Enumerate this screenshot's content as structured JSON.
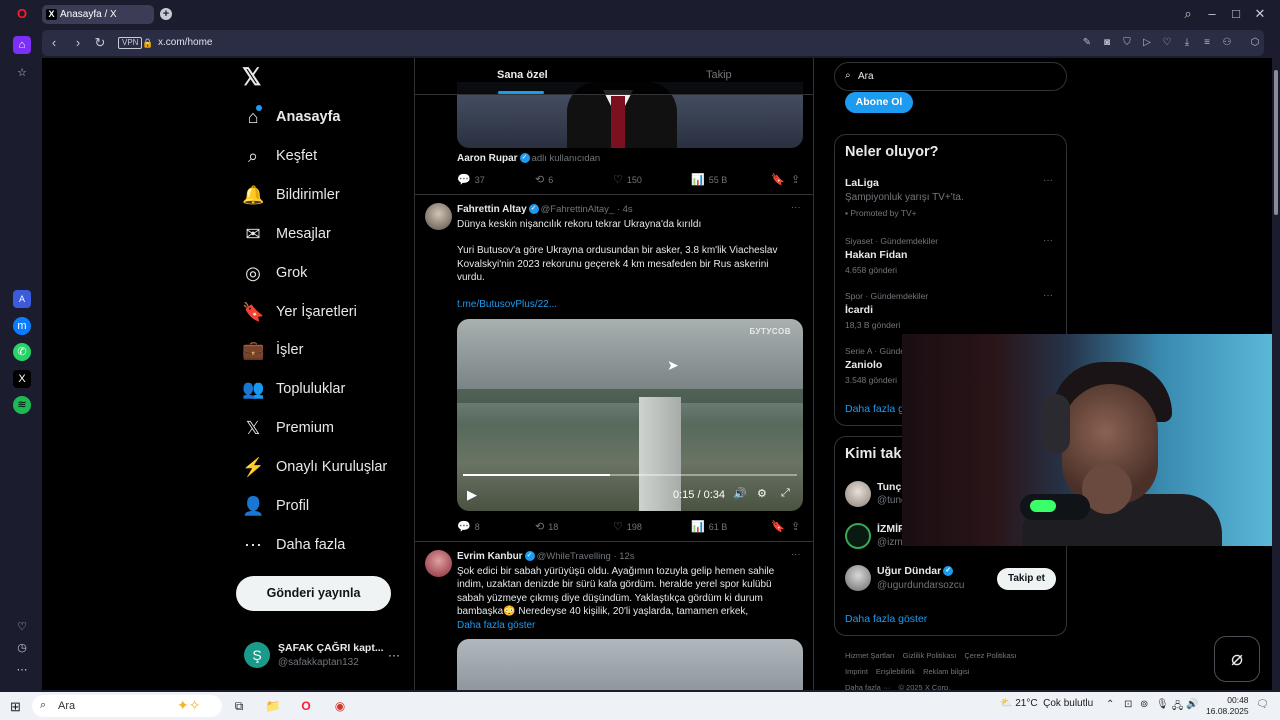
{
  "browser": {
    "tab_title": "Anasayfa / X",
    "url": "x.com/home",
    "vpn_label": "VPN"
  },
  "nav": {
    "logo": "𝕏",
    "items": [
      {
        "label": "Anasayfa",
        "icon": "home-icon",
        "glyph": "⌂"
      },
      {
        "label": "Keşfet",
        "icon": "search-icon",
        "glyph": "⌕"
      },
      {
        "label": "Bildirimler",
        "icon": "bell-icon",
        "glyph": "🔔"
      },
      {
        "label": "Mesajlar",
        "icon": "mail-icon",
        "glyph": "✉"
      },
      {
        "label": "Grok",
        "icon": "grok-icon",
        "glyph": "◎"
      },
      {
        "label": "Yer İşaretleri",
        "icon": "bookmark-icon",
        "glyph": "🔖"
      },
      {
        "label": "İşler",
        "icon": "briefcase-icon",
        "glyph": "💼"
      },
      {
        "label": "Topluluklar",
        "icon": "people-icon",
        "glyph": "👥"
      },
      {
        "label": "Premium",
        "icon": "x-premium-icon",
        "glyph": "𝕏"
      },
      {
        "label": "Onaylı Kuruluşlar",
        "icon": "lightning-icon",
        "glyph": "⚡"
      },
      {
        "label": "Profil",
        "icon": "person-icon",
        "glyph": "👤"
      },
      {
        "label": "Daha fazla",
        "icon": "more-circle-icon",
        "glyph": "⋯"
      }
    ],
    "post_button": "Gönderi yayınla",
    "account": {
      "avatar_letter": "Ş",
      "name": "ŞAFAK ÇAĞRI kapt...",
      "handle": "@safakkaptan132",
      "more": "···"
    }
  },
  "timeline": {
    "tabs": [
      "Sana özel",
      "Takip"
    ],
    "tweet0": {
      "name": "Aaron Rupar",
      "label": "adlı kullanıcıdan",
      "replies": "37",
      "retweets": "6",
      "likes": "150",
      "views": "55 B"
    },
    "tweet1": {
      "name": "Fahrettin Altay",
      "handle": "@FahrettinAltay_",
      "time": "· 4s",
      "line1": "Dünya keskin nişancılık rekoru tekrar Ukrayna'da kırıldı",
      "line2": "Yuri Butusov'a göre Ukrayna ordusundan bir asker, 3.8 km'lik Viacheslav",
      "line3": "Kovalskyi'nin 2023 rekorunu geçerek 4 km mesafeden bir Rus askerini",
      "line4": "vurdu.",
      "link": "t.me/ButusovPlus/22...",
      "video_logo": "БУТУСОВ",
      "video_time": "0:15 / 0:34",
      "video_progress": 0.44,
      "replies": "8",
      "retweets": "18",
      "likes": "198",
      "views": "61 B"
    },
    "tweet2": {
      "name": "Evrim Kanbur",
      "handle": "@WhileTravelling",
      "time": "· 12s",
      "line1": "Şok edici bir sabah yürüyüşü oldu. Ayağımın tozuyla gelip hemen sahile",
      "line2": "indim, uzaktan denizde bir sürü kafa gördüm. heralde yerel spor kulübü",
      "line3": "sabah yüzmeye çıkmış diye düşündüm. Yaklaştıkça gördüm ki durum",
      "line4": "bambaşka😳 Neredeyse 40 kişilik, 20'li yaşlarda, tamamen erkek,",
      "show_more": "Daha fazla göster"
    }
  },
  "right": {
    "search_placeholder": "Ara",
    "subscribe": "Abone Ol",
    "trends_title": "Neler oluyor?",
    "trends": [
      {
        "meta": "",
        "name": "LaLiga",
        "desc": "Şampiyonluk yarışı TV+'ta.",
        "promo": "Promoted by TV+"
      },
      {
        "meta": "Siyaset · Gündemdekiler",
        "name": "Hakan Fidan",
        "count": "4.658 gönderi"
      },
      {
        "meta": "Spor · Gündemdekiler",
        "name": "İcardi",
        "count": "18,3 B gönderi"
      },
      {
        "meta": "Serie A · Günde",
        "name": "Zaniolo",
        "count": "3.548 gönderi"
      }
    ],
    "trends_more": "Daha fazla gö",
    "who_title": "Kimi taki",
    "who": [
      {
        "name": "Tunç",
        "handle": "@tunc"
      },
      {
        "name": "İZMİR",
        "handle": "@izm"
      },
      {
        "name": "Uğur Dündar",
        "handle": "@ugurdundarsozcu"
      }
    ],
    "follow": "Takip et",
    "who_more": "Daha fazla göster",
    "footer": [
      "Hizmet Şartları",
      "Gizlilik Politikası",
      "Çerez Politikası",
      "Imprint",
      "Erişilebilirlik",
      "Reklam bilgisi",
      "Daha fazla ···",
      "© 2025 X Corp."
    ]
  },
  "taskbar": {
    "search": "Ara",
    "weather_temp": "21°C",
    "weather_desc": "Çok bulutlu",
    "time": "00:48",
    "date": "16.08.2025"
  }
}
